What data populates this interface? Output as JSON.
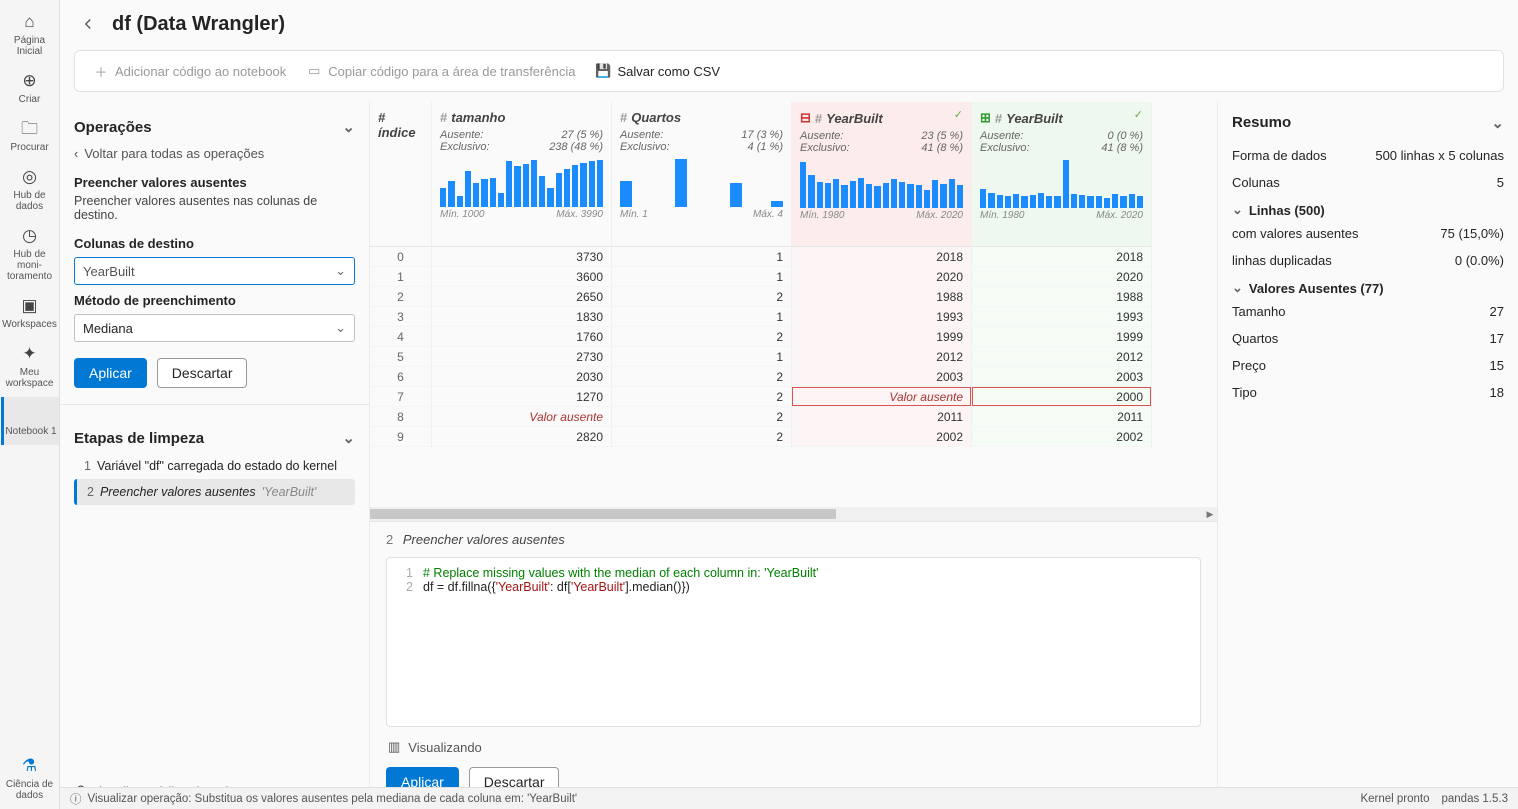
{
  "rail": [
    {
      "label": "Página Inicial",
      "icon": "home"
    },
    {
      "label": "Criar",
      "icon": "plus"
    },
    {
      "label": "Procurar",
      "icon": "folder"
    },
    {
      "label": "Hub de dados",
      "icon": "db"
    },
    {
      "label": "Hub de moni­toramento",
      "icon": "monitor"
    },
    {
      "label": "Workspaces",
      "icon": "workspaces"
    },
    {
      "label": "Meu workspace",
      "icon": "diamond"
    },
    {
      "label": "Notebook 1",
      "icon": "code",
      "selected": true
    }
  ],
  "rail_footer": {
    "label": "Ciência de dados"
  },
  "title": "df (Data Wrangler)",
  "toolbar": {
    "add": "Adicionar código ao notebook",
    "copy": "Copiar código para a área de transferência",
    "save": "Salvar como CSV"
  },
  "operations": {
    "header": "Operações",
    "back": "Voltar para todas as operações",
    "op_title": "Preencher valores ausentes",
    "op_desc": "Preencher valores ausentes nas colunas de destino.",
    "dest_label": "Colunas de destino",
    "dest_value": "YearBuilt",
    "method_label": "Método de preenchimento",
    "method_value": "Mediana",
    "apply": "Aplicar",
    "discard": "Descartar"
  },
  "steps": {
    "header": "Etapas de limpeza",
    "items": [
      {
        "n": "1",
        "name": "Variável \"df\" carregada do estado do kernel"
      },
      {
        "n": "2",
        "name": "Preencher valores ausentes",
        "sub": "'YearBuilt'",
        "active": true
      }
    ],
    "all_link": "Visualizar código de todas as etapas"
  },
  "columns": [
    {
      "key": "idx",
      "title": "# índice",
      "type": "idx"
    },
    {
      "key": "tamanho",
      "title": "# tamanho",
      "ausente": "27 (5 %)",
      "exclusivo": "238 (48 %)",
      "min": "Mín. 1000",
      "max": "Máx. 3990",
      "spark": [
        40,
        55,
        22,
        75,
        50,
        58,
        60,
        30,
        95,
        85,
        90,
        98,
        65,
        40,
        70,
        80,
        88,
        92,
        96,
        98
      ]
    },
    {
      "key": "quartos",
      "title": "# Quartos",
      "ausente": "17 (3 %)",
      "exclusivo": "4 (1 %)",
      "min": "Mín. 1",
      "max": "Máx. 4",
      "spark": [
        55,
        0,
        0,
        0,
        100,
        0,
        0,
        0,
        50,
        0,
        0,
        12
      ]
    },
    {
      "key": "yb_old",
      "title": "# YearBuilt",
      "variant": "red",
      "diff": "minus",
      "ausente": "23 (5 %)",
      "exclusivo": "41 (8 %)",
      "min": "Mín. 1980",
      "max": "Máx. 2020",
      "spark": [
        95,
        68,
        55,
        52,
        60,
        48,
        56,
        62,
        50,
        45,
        52,
        60,
        55,
        50,
        48,
        38,
        58,
        50,
        60,
        48
      ]
    },
    {
      "key": "yb_new",
      "title": "# YearBuilt",
      "variant": "green",
      "diff": "plus",
      "ausente": "0 (0 %)",
      "exclusivo": "41 (8 %)",
      "min": "Mín. 1980",
      "max": "Máx. 2020",
      "spark": [
        40,
        32,
        28,
        26,
        30,
        24,
        28,
        32,
        26,
        24,
        100,
        30,
        28,
        26,
        24,
        20,
        30,
        26,
        30,
        24
      ]
    }
  ],
  "labels": {
    "ausente": "Ausente:",
    "exclusivo": "Exclusivo:"
  },
  "rows": [
    {
      "idx": "0",
      "tamanho": "3730",
      "quartos": "1",
      "yb_old": "2018",
      "yb_new": "2018"
    },
    {
      "idx": "1",
      "tamanho": "3600",
      "quartos": "1",
      "yb_old": "2020",
      "yb_new": "2020"
    },
    {
      "idx": "2",
      "tamanho": "2650",
      "quartos": "2",
      "yb_old": "1988",
      "yb_new": "1988"
    },
    {
      "idx": "3",
      "tamanho": "1830",
      "quartos": "1",
      "yb_old": "1993",
      "yb_new": "1993"
    },
    {
      "idx": "4",
      "tamanho": "1760",
      "quartos": "2",
      "yb_old": "1999",
      "yb_new": "1999"
    },
    {
      "idx": "5",
      "tamanho": "2730",
      "quartos": "1",
      "yb_old": "2012",
      "yb_new": "2012"
    },
    {
      "idx": "6",
      "tamanho": "2030",
      "quartos": "2",
      "yb_old": "2003",
      "yb_new": "2003"
    },
    {
      "idx": "7",
      "tamanho": "1270",
      "quartos": "2",
      "yb_old": "Valor ausente",
      "yb_new": "2000",
      "hl": true
    },
    {
      "idx": "8",
      "tamanho": "Valor ausente",
      "quartos": "2",
      "yb_old": "2011",
      "yb_new": "2011"
    },
    {
      "idx": "9",
      "tamanho": "2820",
      "quartos": "2",
      "yb_old": "2002",
      "yb_new": "2002"
    }
  ],
  "code": {
    "title_n": "2",
    "title": "Preencher valores ausentes",
    "lines": [
      {
        "n": "1",
        "html": "<span class='tok-comment'># Replace missing values with the median of each column in: 'YearBuilt'</span>"
      },
      {
        "n": "2",
        "html": "df = df.fillna({<span class='tok-str'>'YearBuilt'</span>: df[<span class='tok-str'>'YearBuilt'</span>].median()})"
      }
    ],
    "viewing": "Visualizando",
    "apply": "Aplicar",
    "discard": "Descartar"
  },
  "summary": {
    "header": "Resumo",
    "shape_label": "Forma de dados",
    "shape_val": "500 linhas x 5 colunas",
    "cols_label": "Colunas",
    "cols_val": "5",
    "rows_header": "Linhas (500)",
    "missing_label": "com valores ausentes",
    "missing_val": "75 (15,0%)",
    "dup_label": "linhas duplicadas",
    "dup_val": "0 (0.0%)",
    "mv_header": "Valores Ausentes (77)",
    "mv": [
      {
        "k": "Tamanho",
        "v": "27"
      },
      {
        "k": "Quartos",
        "v": "17"
      },
      {
        "k": "Preço",
        "v": "15"
      },
      {
        "k": "Tipo",
        "v": "18"
      }
    ]
  },
  "status": {
    "msg": "Visualizar operação: Substitua os valores ausentes pela mediana de cada coluna em: 'YearBuilt'",
    "kernel": "Kernel pronto",
    "pandas": "pandas 1.5.3"
  }
}
